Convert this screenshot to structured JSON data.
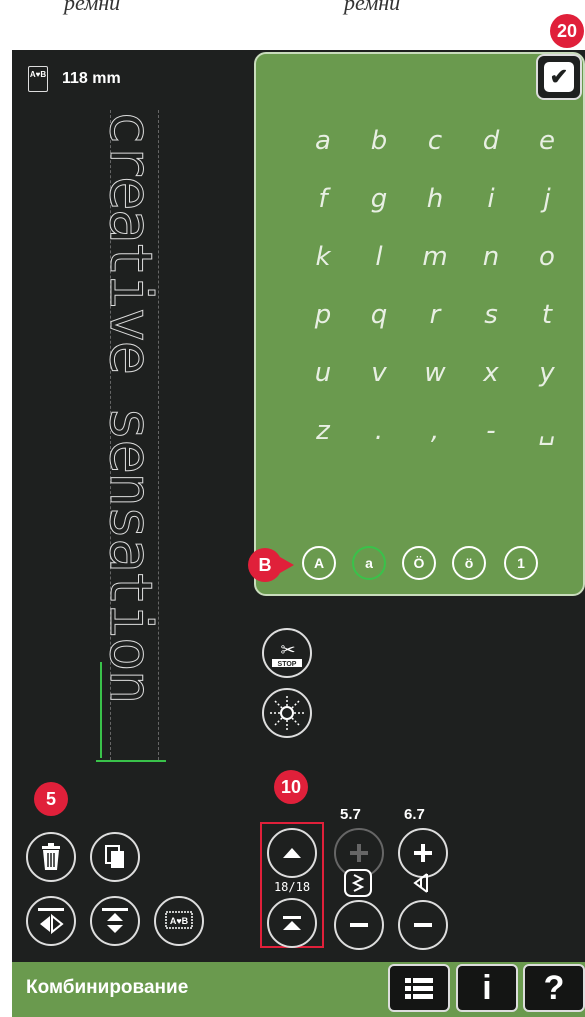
{
  "top_captions": [
    "ремни",
    "ремни"
  ],
  "size_label": "118 mm",
  "size_icon_text": "A♥B",
  "preview_text": "creative sensation",
  "keyboard": {
    "rows": [
      [
        "a",
        "b",
        "c",
        "d",
        "e"
      ],
      [
        "f",
        "g",
        "h",
        "i",
        "j"
      ],
      [
        "k",
        "l",
        "m",
        "n",
        "o"
      ],
      [
        "p",
        "q",
        "r",
        "s",
        "t"
      ],
      [
        "u",
        "v",
        "w",
        "x",
        "y"
      ],
      [
        "z",
        ".",
        ",",
        "-",
        "␣"
      ]
    ],
    "modes": [
      "A",
      "a",
      "Ö",
      "ö",
      "1"
    ],
    "active_mode": "a",
    "ok_icon": "checkmark-icon"
  },
  "markers": {
    "m20": "20",
    "mB": "B",
    "m5": "5",
    "m10": "10",
    "m18": "18"
  },
  "stitch_controls": {
    "width_value": "5.7",
    "length_value": "6.7",
    "position": "18/18"
  },
  "bottom_bar": {
    "title": "Комбинирование",
    "info_label": "i",
    "help_label": "?"
  },
  "colors": {
    "accent_green": "#6a9a4e",
    "marker_red": "#e0203a",
    "screen_dark": "#1e201f",
    "active_mode": "#39c24a"
  }
}
